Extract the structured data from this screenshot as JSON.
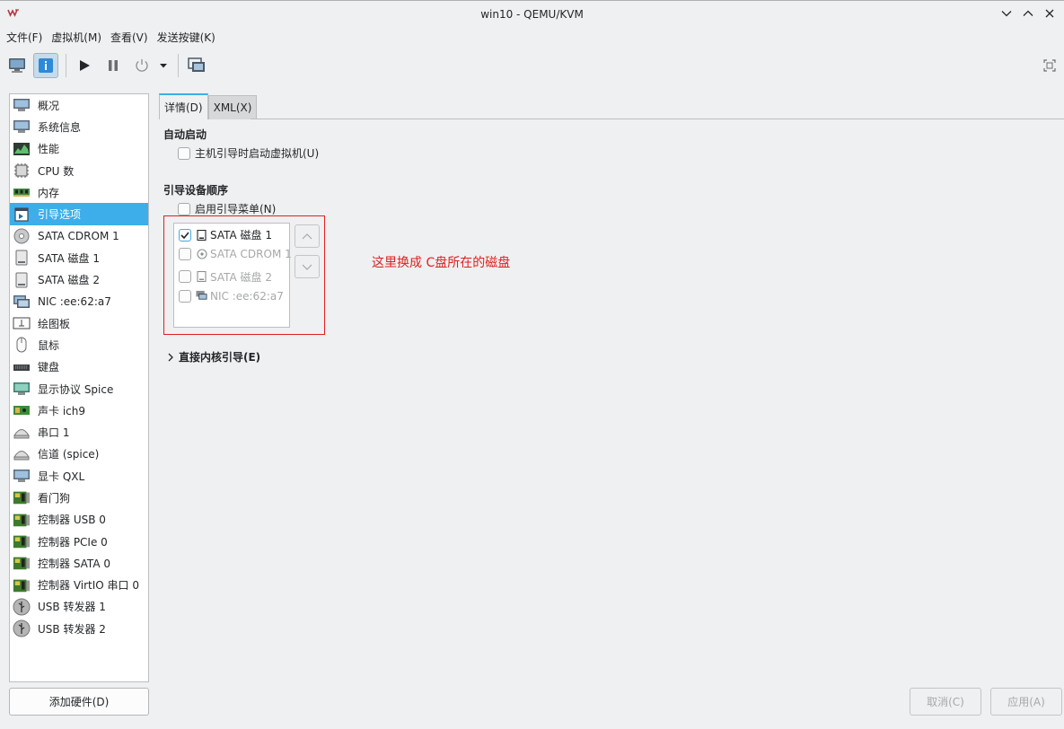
{
  "window": {
    "title": "win10 - QEMU/KVM"
  },
  "menu": [
    "文件(F)",
    "虚拟机(M)",
    "查看(V)",
    "发送按键(K)"
  ],
  "sidebar": {
    "items": [
      {
        "label": "概况",
        "icon": "monitor-icon"
      },
      {
        "label": "系统信息",
        "icon": "monitor-icon"
      },
      {
        "label": "性能",
        "icon": "performance-graph-icon"
      },
      {
        "label": "CPU 数",
        "icon": "cpu-chip-icon"
      },
      {
        "label": "内存",
        "icon": "memory-module-icon"
      },
      {
        "label": "引导选项",
        "icon": "boot-options-icon",
        "selected": true
      },
      {
        "label": "SATA CDROM 1",
        "icon": "cdrom-icon"
      },
      {
        "label": "SATA 磁盘 1",
        "icon": "disk-icon"
      },
      {
        "label": "SATA 磁盘 2",
        "icon": "disk-icon"
      },
      {
        "label": "NIC :ee:62:a7",
        "icon": "network-icon"
      },
      {
        "label": "绘图板",
        "icon": "tablet-icon"
      },
      {
        "label": "鼠标",
        "icon": "mouse-icon"
      },
      {
        "label": "键盘",
        "icon": "keyboard-icon"
      },
      {
        "label": "显示协议 Spice",
        "icon": "display-icon"
      },
      {
        "label": "声卡 ich9",
        "icon": "sound-card-icon"
      },
      {
        "label": "串口 1",
        "icon": "serial-port-icon"
      },
      {
        "label": "信道 (spice)",
        "icon": "channel-icon"
      },
      {
        "label": "显卡 QXL",
        "icon": "video-card-icon"
      },
      {
        "label": "看门狗",
        "icon": "controller-card-icon"
      },
      {
        "label": "控制器 USB 0",
        "icon": "controller-card-icon"
      },
      {
        "label": "控制器 PCIe 0",
        "icon": "controller-card-icon"
      },
      {
        "label": "控制器 SATA 0",
        "icon": "controller-card-icon"
      },
      {
        "label": "控制器 VirtIO 串口 0",
        "icon": "controller-card-icon"
      },
      {
        "label": "USB 转发器 1",
        "icon": "usb-icon"
      },
      {
        "label": "USB 转发器 2",
        "icon": "usb-icon"
      }
    ],
    "add_hardware": "添加硬件(D)"
  },
  "tabs": {
    "details": "详情(D)",
    "xml": "XML(X)"
  },
  "autostart": {
    "title": "自动启动",
    "checkbox_label": "主机引导时启动虚拟机(U)",
    "checked": false
  },
  "boot_order": {
    "title": "引导设备顺序",
    "enable_menu_label": "启用引导菜单(N)",
    "enable_menu_checked": false,
    "devices": [
      {
        "label": "SATA 磁盘 1",
        "checked": true,
        "enabled": true,
        "icon": "disk-icon"
      },
      {
        "label": "SATA CDROM 1",
        "checked": false,
        "enabled": false,
        "icon": "cdrom-icon"
      },
      {
        "label": "SATA 磁盘 2",
        "checked": false,
        "enabled": false,
        "icon": "disk-icon"
      },
      {
        "label": "NIC :ee:62:a7",
        "checked": false,
        "enabled": false,
        "icon": "network-icon"
      }
    ]
  },
  "annotation": "这里换成 C盘所在的磁盘",
  "direct_kernel": "直接内核引导(E)",
  "buttons": {
    "cancel": "取消(C)",
    "apply": "应用(A)"
  },
  "colors": {
    "accent": "#3daee9",
    "annotation": "#e02020"
  }
}
